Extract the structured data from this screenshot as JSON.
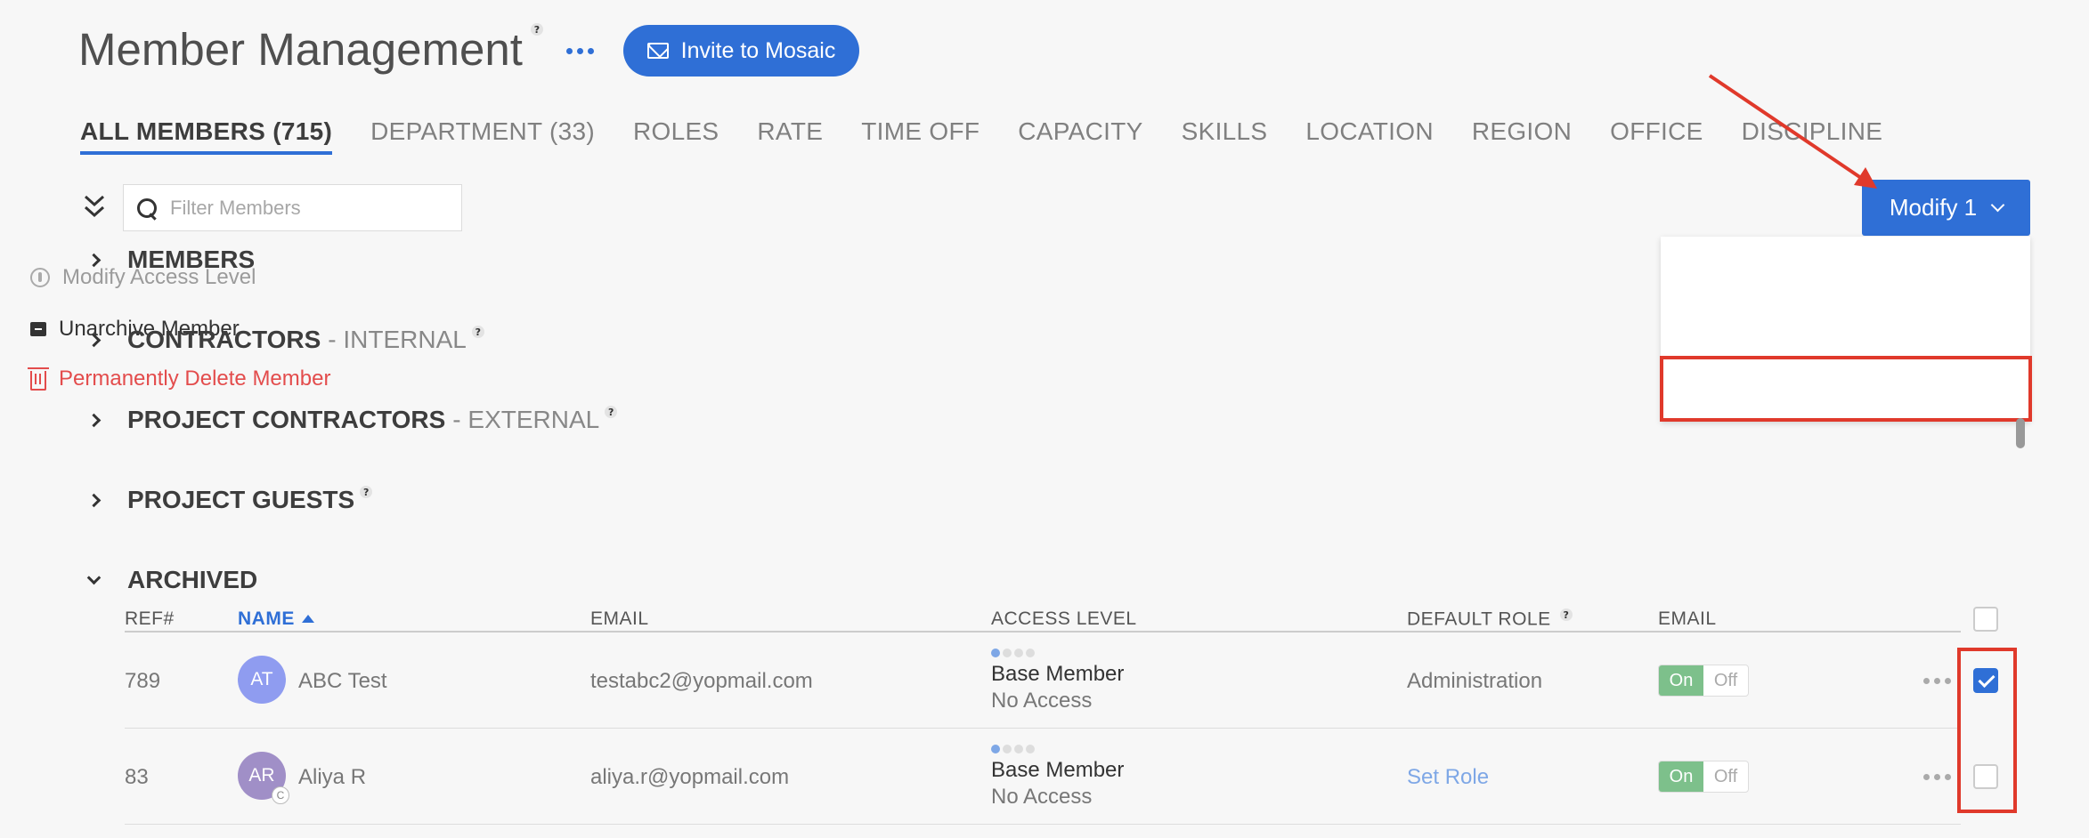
{
  "header": {
    "title": "Member Management",
    "help": "?",
    "invite_label": "Invite to Mosaic"
  },
  "tabs": [
    {
      "label": "ALL MEMBERS (715)",
      "active": true
    },
    {
      "label": "DEPARTMENT (33)"
    },
    {
      "label": "ROLES"
    },
    {
      "label": "RATE"
    },
    {
      "label": "TIME OFF"
    },
    {
      "label": "CAPACITY"
    },
    {
      "label": "SKILLS"
    },
    {
      "label": "LOCATION"
    },
    {
      "label": "REGION"
    },
    {
      "label": "OFFICE"
    },
    {
      "label": "DISCIPLINE"
    }
  ],
  "filter": {
    "placeholder": "Filter Members"
  },
  "modify": {
    "label": "Modify 1",
    "menu": {
      "access": "Modify Access Level",
      "unarchive": "Unarchive Member",
      "delete": "Permanently Delete Member"
    }
  },
  "sections": {
    "members": "MEMBERS",
    "contractors": "CONTRACTORS",
    "contractors_sub": "- INTERNAL",
    "project_contractors": "PROJECT CONTRACTORS",
    "project_contractors_sub": "- EXTERNAL",
    "project_guests": "PROJECT GUESTS",
    "archived": "ARCHIVED"
  },
  "table": {
    "headers": {
      "ref": "REF#",
      "name": "NAME",
      "email": "EMAIL",
      "access": "ACCESS LEVEL",
      "role": "DEFAULT ROLE",
      "email_notify": "EMAIL"
    },
    "rows": [
      {
        "ref": "789",
        "initials": "AT",
        "name": "ABC Test",
        "email": "testabc2@yopmail.com",
        "access_main": "Base Member",
        "access_sub": "No Access",
        "role": "Administration",
        "toggle_on": "On",
        "toggle_off": "Off",
        "checked": true,
        "avatar_color": "#8f9cf0"
      },
      {
        "ref": "83",
        "initials": "AR",
        "badge": "C",
        "name": "Aliya R",
        "email": "aliya.r@yopmail.com",
        "access_main": "Base Member",
        "access_sub": "No Access",
        "role": "Set Role",
        "toggle_on": "On",
        "toggle_off": "Off",
        "checked": false,
        "avatar_color": "#a08fc7"
      }
    ]
  },
  "colors": {
    "accent": "#2f6fd6",
    "danger": "#e34c4c",
    "annotation": "#e0392b"
  }
}
